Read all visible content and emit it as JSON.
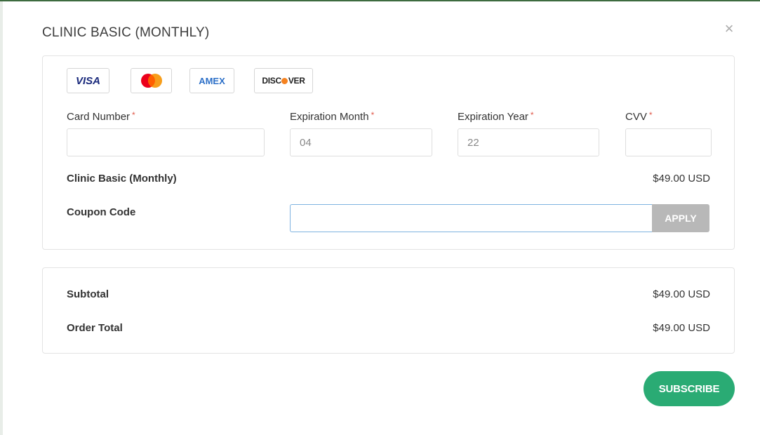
{
  "modal": {
    "title": "CLINIC BASIC (MONTHLY)",
    "close_icon": "×"
  },
  "payment": {
    "card_brands": [
      {
        "name": "VISA",
        "icon": "visa-logo"
      },
      {
        "name": "Mastercard",
        "icon": "mastercard-logo"
      },
      {
        "name": "AMEX",
        "icon": "amex-logo"
      },
      {
        "name": "DISCOVER",
        "icon": "discover-logo"
      }
    ],
    "card_number": {
      "label": "Card Number",
      "required": "*",
      "value": ""
    },
    "exp_month": {
      "label": "Expiration Month",
      "required": "*",
      "value": "04"
    },
    "exp_year": {
      "label": "Expiration Year",
      "required": "*",
      "value": "22"
    },
    "cvv": {
      "label": "CVV",
      "required": "*",
      "value": ""
    },
    "plan": {
      "name": "Clinic Basic (Monthly)",
      "price": "$49.00 USD"
    },
    "coupon": {
      "label": "Coupon Code",
      "value": "",
      "apply_label": "APPLY"
    }
  },
  "summary": {
    "subtotal_label": "Subtotal",
    "subtotal_value": "$49.00 USD",
    "total_label": "Order Total",
    "total_value": "$49.00 USD"
  },
  "actions": {
    "subscribe_label": "SUBSCRIBE"
  },
  "colors": {
    "subscribe": "#2aab74",
    "apply": "#b8b8b8",
    "required": "#e05a4b",
    "coupon_focus": "#7fb3e0"
  }
}
